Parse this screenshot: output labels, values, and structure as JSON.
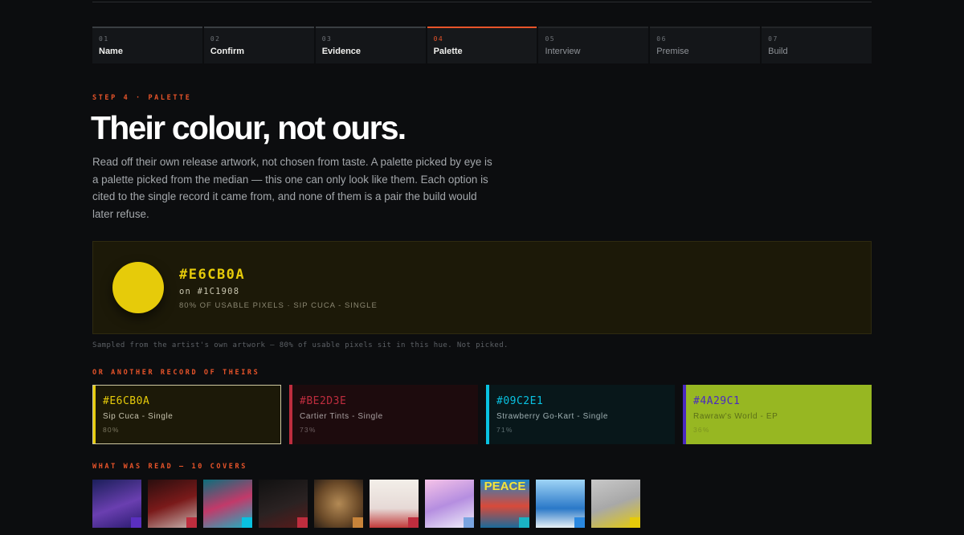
{
  "stepper": [
    {
      "num": "01",
      "label": "Name",
      "state": "done"
    },
    {
      "num": "02",
      "label": "Confirm",
      "state": "done"
    },
    {
      "num": "03",
      "label": "Evidence",
      "state": "done"
    },
    {
      "num": "04",
      "label": "Palette",
      "state": "active"
    },
    {
      "num": "05",
      "label": "Interview",
      "state": "future"
    },
    {
      "num": "06",
      "label": "Premise",
      "state": "future"
    },
    {
      "num": "07",
      "label": "Build",
      "state": "future"
    }
  ],
  "eyebrow": "STEP 4 · PALETTE",
  "headline": "Their colour, not ours.",
  "lede": "Read off their own release artwork, not chosen from taste. A palette picked by eye is a palette picked from the median — this one can only look like them. Each option is cited to the single record it came from, and none of them is a pair the build would later refuse.",
  "hero": {
    "hex": "#E6CB0A",
    "on": "on #1C1908",
    "meta": "80% OF USABLE PIXELS · SIP CUCA - SINGLE",
    "color": "#e6cb0a",
    "bg": "#1c1908"
  },
  "note": "Sampled from the artist's own artwork — 80% of usable pixels sit in this hue. Not picked.",
  "options_heading": "OR ANOTHER RECORD OF THEIRS",
  "options": [
    {
      "hex": "#E6CB0A",
      "title": "Sip Cuca - Single",
      "pct": "80%",
      "fg": "#e6cb0a",
      "bg": "#1c1908",
      "text": "#c7c3ae",
      "sub": "#7a7660",
      "selected": true
    },
    {
      "hex": "#BE2D3E",
      "title": "Cartier Tints - Single",
      "pct": "73%",
      "fg": "#be2d3e",
      "bg": "#1d0b0d",
      "text": "#a9a1a2",
      "sub": "#6e6062",
      "selected": false
    },
    {
      "hex": "#09C2E1",
      "title": "Strawberry Go-Kart - Single",
      "pct": "71%",
      "fg": "#09c2e1",
      "bg": "#08171a",
      "text": "#9fb0b3",
      "sub": "#5e6e71",
      "selected": false
    },
    {
      "hex": "#4A29C1",
      "title": "Rawraw's World - EP",
      "pct": "36%",
      "fg": "#4a29c1",
      "bg": "#97b722",
      "text": "#5b6e18",
      "sub": "#7d9420",
      "selected": false
    }
  ],
  "covers_heading": "WHAT WAS READ — 10 COVERS",
  "covers": [
    {
      "text": "",
      "bg": "linear-gradient(160deg,#1b1f5a,#6a3fb0 55%,#2a1b70)",
      "chip": "#5a2fc0"
    },
    {
      "text": "",
      "bg": "linear-gradient(160deg,#2a0e0e,#7a1a1a 50%,#c8b4b0)",
      "chip": "#be2d3e"
    },
    {
      "text": "",
      "bg": "linear-gradient(160deg,#0a6f7c,#c23a6a 50%,#1ab3c4)",
      "chip": "#09c2e1"
    },
    {
      "text": "",
      "bg": "linear-gradient(160deg,#111,#2a2222 55%,#5a1a1a)",
      "chip": "#be2d3e"
    },
    {
      "text": "",
      "bg": "radial-gradient(circle at 50% 50%,#b38a55,#6b4a28 60%,#2b2018)",
      "chip": "#c8843a"
    },
    {
      "text": "",
      "bg": "linear-gradient(180deg,#f3efe9,#e6d9d6 60%,#c23a3a)",
      "chip": "#be2d3e"
    },
    {
      "text": "",
      "bg": "linear-gradient(160deg,#f6c3e8,#b58ee0 50%,#f0f0fa)",
      "chip": "#7aa4e0"
    },
    {
      "text": "PEACE",
      "bg": "linear-gradient(180deg,#1d88c8,#d84a3a 55%,#1a6a9a)",
      "chip": "#1ab3c4"
    },
    {
      "text": "",
      "bg": "linear-gradient(180deg,#9fd4f6,#2a78c8 60%,#e8f0f6)",
      "chip": "#2a88e0"
    },
    {
      "text": "",
      "bg": "linear-gradient(160deg,#c8c8c8,#a8a8a8 50%,#e6cb0a)",
      "chip": "#e6cb0a"
    }
  ]
}
